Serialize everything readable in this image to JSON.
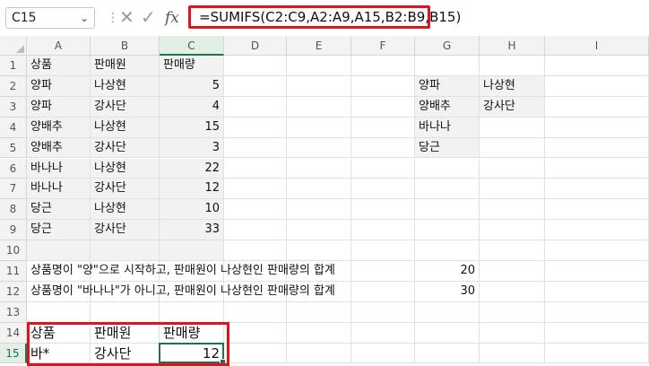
{
  "formula_bar": {
    "name_box": "C15",
    "cancel_icon": "✕",
    "enter_icon": "✓",
    "fx_label": "fx",
    "formula": "=SUMIFS(C2:C9,A2:A9,A15,B2:B9,B15)"
  },
  "columns": [
    "A",
    "B",
    "C",
    "D",
    "E",
    "F",
    "G",
    "H",
    "I"
  ],
  "rows": [
    "1",
    "2",
    "3",
    "4",
    "5",
    "6",
    "7",
    "8",
    "9",
    "10",
    "11",
    "12",
    "13",
    "14",
    "15"
  ],
  "table": {
    "headers": [
      "상품",
      "판매원",
      "판매량"
    ],
    "rows": [
      [
        "양파",
        "나상현",
        "5"
      ],
      [
        "양파",
        "강사단",
        "4"
      ],
      [
        "양배추",
        "나상현",
        "15"
      ],
      [
        "양배추",
        "강사단",
        "3"
      ],
      [
        "바나나",
        "나상현",
        "22"
      ],
      [
        "바나나",
        "강사단",
        "12"
      ],
      [
        "당근",
        "나상현",
        "10"
      ],
      [
        "당근",
        "강사단",
        "33"
      ]
    ]
  },
  "lookup": {
    "g": [
      "양파",
      "양배추",
      "바나나",
      "당근"
    ],
    "h": [
      "나상현",
      "강사단",
      "",
      ""
    ]
  },
  "summary": {
    "row11_label": "상품명이 \"양\"으로 시작하고, 판매원이 나상현인 판매량의 합계",
    "row11_value": "20",
    "row12_label": "상품명이 \"바나나\"가 아니고, 판매원이 나상현인 판매량의 합계",
    "row12_value": "30"
  },
  "criteria": {
    "headers": [
      "상품",
      "판매원",
      "판매량"
    ],
    "values": [
      "바*",
      "강사단",
      "12"
    ]
  },
  "colors": {
    "highlight_red": "#e0141e",
    "excel_green": "#217346"
  }
}
